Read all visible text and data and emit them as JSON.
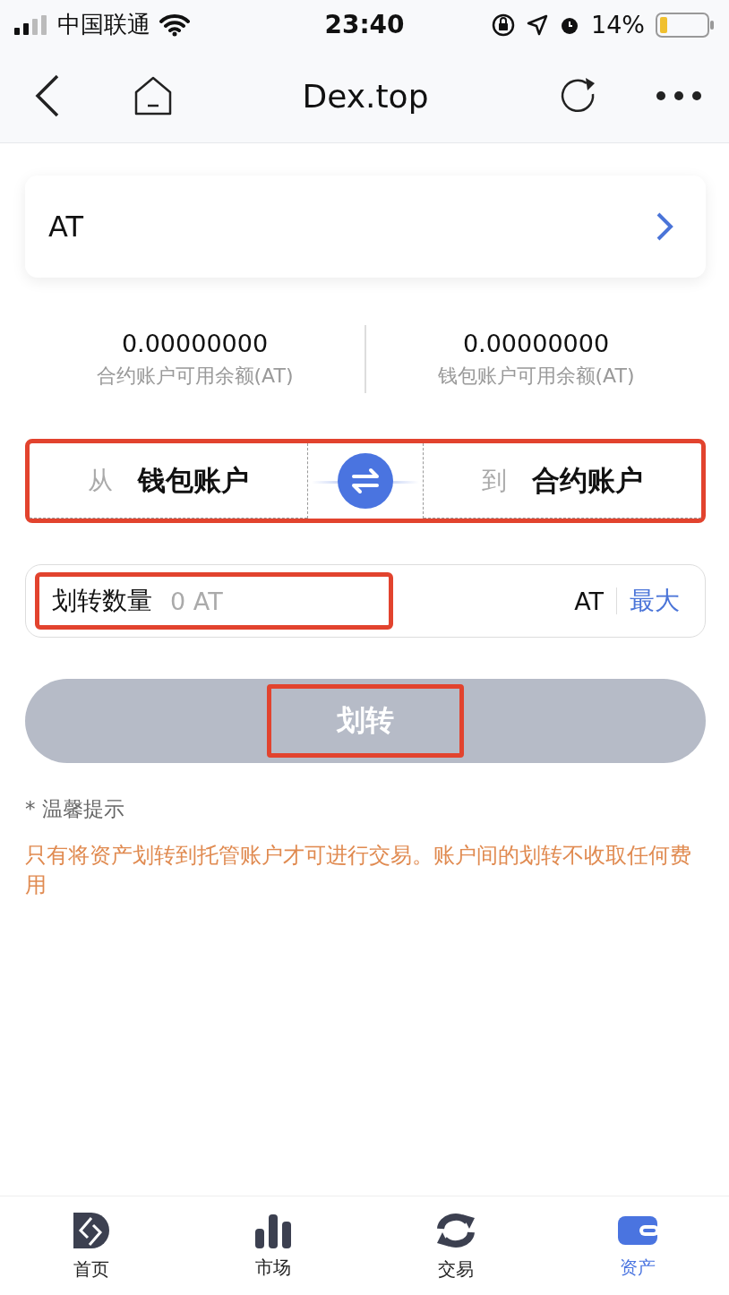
{
  "status_bar": {
    "carrier": "中国联通",
    "time": "23:40",
    "battery": "14%"
  },
  "nav": {
    "title": "Dex.top"
  },
  "token": {
    "name": "AT"
  },
  "balances": [
    {
      "amount": "0.00000000",
      "label": "合约账户可用余额(AT)"
    },
    {
      "amount": "0.00000000",
      "label": "钱包账户可用余额(AT)"
    }
  ],
  "transfer": {
    "from_prefix": "从",
    "from": "钱包账户",
    "to_prefix": "到",
    "to": "合约账户"
  },
  "amount": {
    "label": "划转数量",
    "placeholder": "0 AT",
    "unit": "AT",
    "max": "最大"
  },
  "submit": {
    "label": "划转",
    "disabled": true
  },
  "tip": {
    "title": "* 温馨提示",
    "text": "只有将资产划转到托管账户才可进行交易。账户间的划转不收取任何费用"
  },
  "tabs": [
    {
      "label": "首页",
      "kind": "home",
      "selected": false
    },
    {
      "label": "市场",
      "kind": "market",
      "selected": false
    },
    {
      "label": "交易",
      "kind": "trade",
      "selected": false
    },
    {
      "label": "资产",
      "kind": "assets",
      "selected": true
    }
  ]
}
